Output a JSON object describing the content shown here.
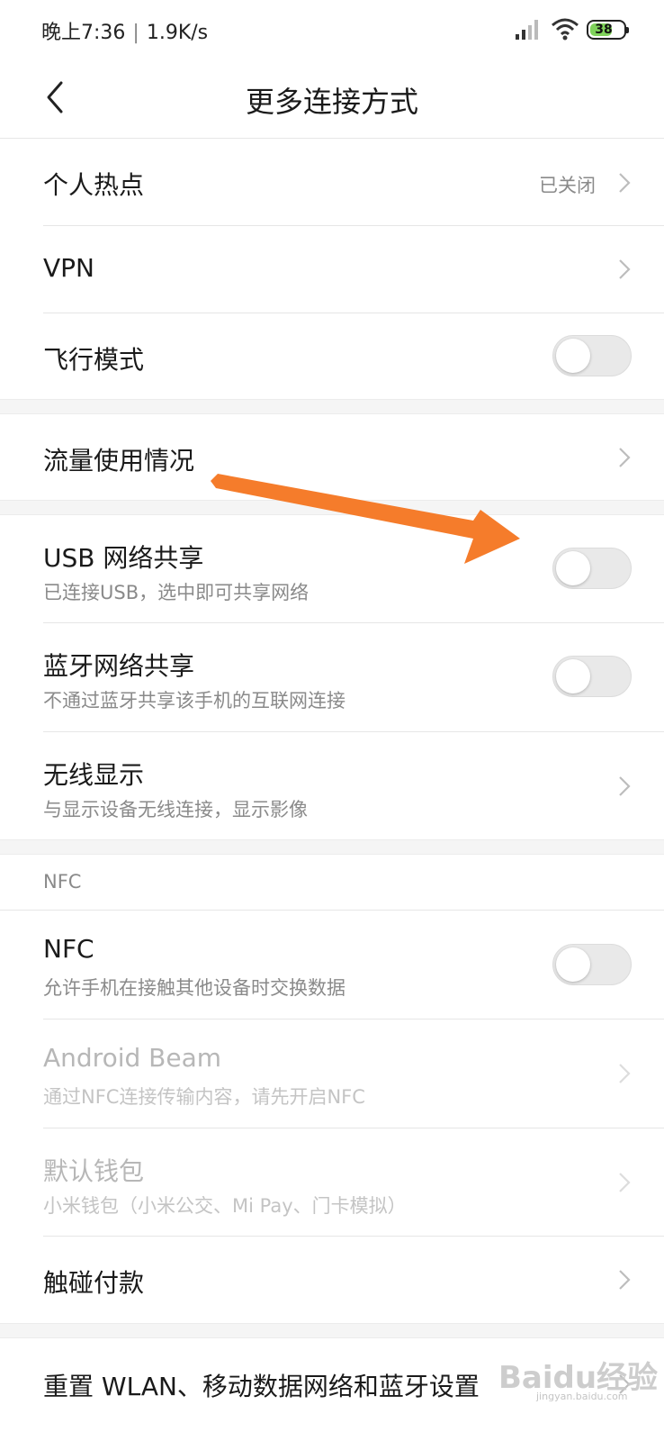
{
  "status_bar": {
    "time": "晚上7:36",
    "speed": "1.9K/s",
    "battery": "38"
  },
  "header": {
    "title": "更多连接方式"
  },
  "items": {
    "hotspot": {
      "label": "个人热点",
      "value": "已关闭"
    },
    "vpn": {
      "label": "VPN"
    },
    "airplane": {
      "label": "飞行模式",
      "enabled": false
    },
    "data_usage": {
      "label": "流量使用情况"
    },
    "usb_tether": {
      "label": "USB 网络共享",
      "sub": "已连接USB，选中即可共享网络",
      "enabled": false
    },
    "bt_tether": {
      "label": "蓝牙网络共享",
      "sub": "不通过蓝牙共享该手机的互联网连接",
      "enabled": false
    },
    "wireless_display": {
      "label": "无线显示",
      "sub": "与显示设备无线连接，显示影像"
    },
    "nfc_section": "NFC",
    "nfc": {
      "label": "NFC",
      "sub": "允许手机在接触其他设备时交换数据",
      "enabled": false
    },
    "android_beam": {
      "label": "Android Beam",
      "sub": "通过NFC连接传输内容，请先开启NFC"
    },
    "default_wallet": {
      "label": "默认钱包",
      "sub": "小米钱包（小米公交、Mi Pay、门卡模拟）"
    },
    "tap_pay": {
      "label": "触碰付款"
    },
    "reset": {
      "label": "重置 WLAN、移动数据网络和蓝牙设置"
    }
  },
  "watermark": {
    "text": "Baidu经验",
    "url": "jingyan.baidu.com"
  },
  "colors": {
    "arrow": "#f57c2b",
    "battery": "#7fd25b"
  }
}
